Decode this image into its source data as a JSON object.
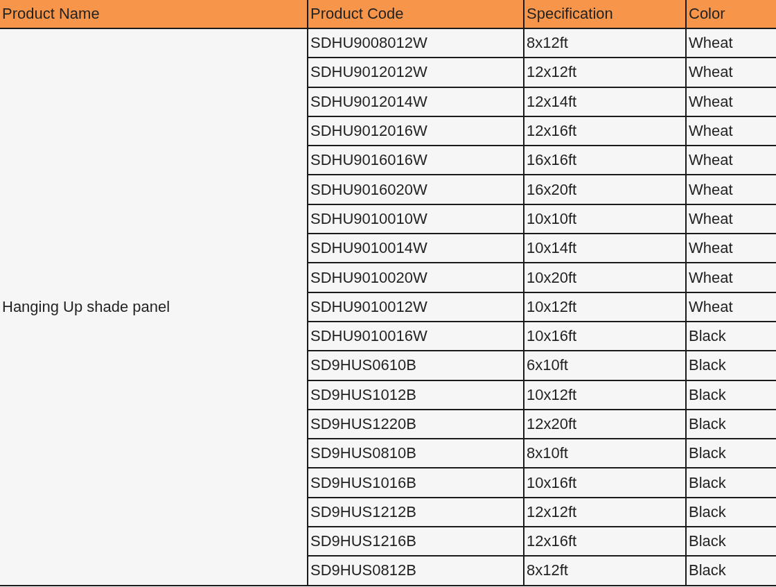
{
  "table": {
    "columns": [
      "Product Name",
      "Product Code",
      "Specification",
      "Color"
    ],
    "product_name": "Hanging Up shade panel",
    "rows": [
      {
        "code": "SDHU9008012W",
        "spec": "8x12ft",
        "color_name": "Wheat"
      },
      {
        "code": "SDHU9012012W",
        "spec": "12x12ft",
        "color_name": "Wheat"
      },
      {
        "code": "SDHU9012014W",
        "spec": "12x14ft",
        "color_name": "Wheat"
      },
      {
        "code": "SDHU9012016W",
        "spec": "12x16ft",
        "color_name": "Wheat"
      },
      {
        "code": "SDHU9016016W",
        "spec": "16x16ft",
        "color_name": "Wheat"
      },
      {
        "code": "SDHU9016020W",
        "spec": "16x20ft",
        "color_name": "Wheat"
      },
      {
        "code": "SDHU9010010W",
        "spec": "10x10ft",
        "color_name": "Wheat"
      },
      {
        "code": "SDHU9010014W",
        "spec": "10x14ft",
        "color_name": "Wheat"
      },
      {
        "code": "SDHU9010020W",
        "spec": "10x20ft",
        "color_name": "Wheat"
      },
      {
        "code": "SDHU9010012W",
        "spec": "10x12ft",
        "color_name": "Wheat"
      },
      {
        "code": "SDHU9010016W",
        "spec": "10x16ft",
        "color_name": "Black"
      },
      {
        "code": "SD9HUS0610B",
        "spec": "6x10ft",
        "color_name": "Black"
      },
      {
        "code": "SD9HUS1012B",
        "spec": "10x12ft",
        "color_name": "Black"
      },
      {
        "code": "SD9HUS1220B",
        "spec": "12x20ft",
        "color_name": "Black"
      },
      {
        "code": "SD9HUS0810B",
        "spec": "8x10ft",
        "color_name": "Black"
      },
      {
        "code": "SD9HUS1016B",
        "spec": "10x16ft",
        "color_name": "Black"
      },
      {
        "code": "SD9HUS1212B",
        "spec": "12x12ft",
        "color_name": "Black"
      },
      {
        "code": "SD9HUS1216B",
        "spec": "12x16ft",
        "color_name": "Black"
      },
      {
        "code": "SD9HUS0812B",
        "spec": "8x12ft",
        "color_name": "Black"
      }
    ]
  }
}
